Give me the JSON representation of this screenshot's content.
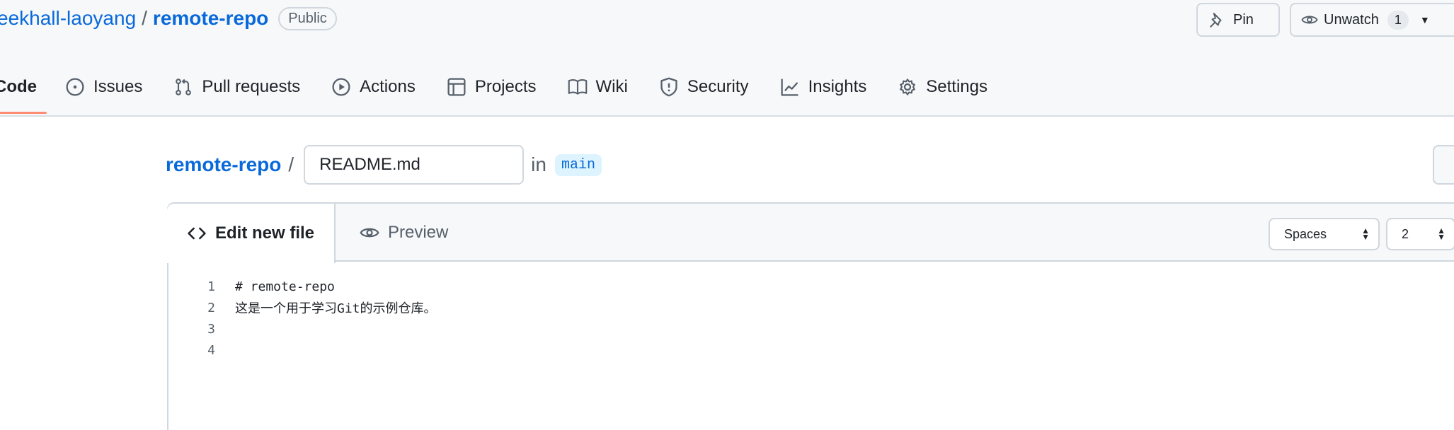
{
  "repo": {
    "owner": "eekhall-laoyang",
    "separator": "/",
    "name": "remote-repo",
    "visibility": "Public"
  },
  "actions": {
    "pin_label": "Pin",
    "watch_label": "Unwatch",
    "watch_count": "1"
  },
  "nav": {
    "code": "Code",
    "issues": "Issues",
    "pull_requests": "Pull requests",
    "actions": "Actions",
    "projects": "Projects",
    "wiki": "Wiki",
    "security": "Security",
    "insights": "Insights",
    "settings": "Settings"
  },
  "path": {
    "repo": "remote-repo",
    "separator": "/",
    "filename": "README.md",
    "in_label": "in",
    "branch": "main"
  },
  "editor": {
    "edit_tab": "Edit new file",
    "preview_tab": "Preview",
    "indent_mode": "Spaces",
    "indent_size": "2",
    "lines": [
      {
        "number": "1",
        "text": "# remote-repo"
      },
      {
        "number": "2",
        "text": "这是一个用于学习Git的示例仓库。"
      },
      {
        "number": "3",
        "text": ""
      },
      {
        "number": "4",
        "text": ""
      }
    ]
  },
  "colors": {
    "link": "#0969da",
    "active_tab_underline": "#fd8c73",
    "branch_bg": "#ddf4ff"
  }
}
